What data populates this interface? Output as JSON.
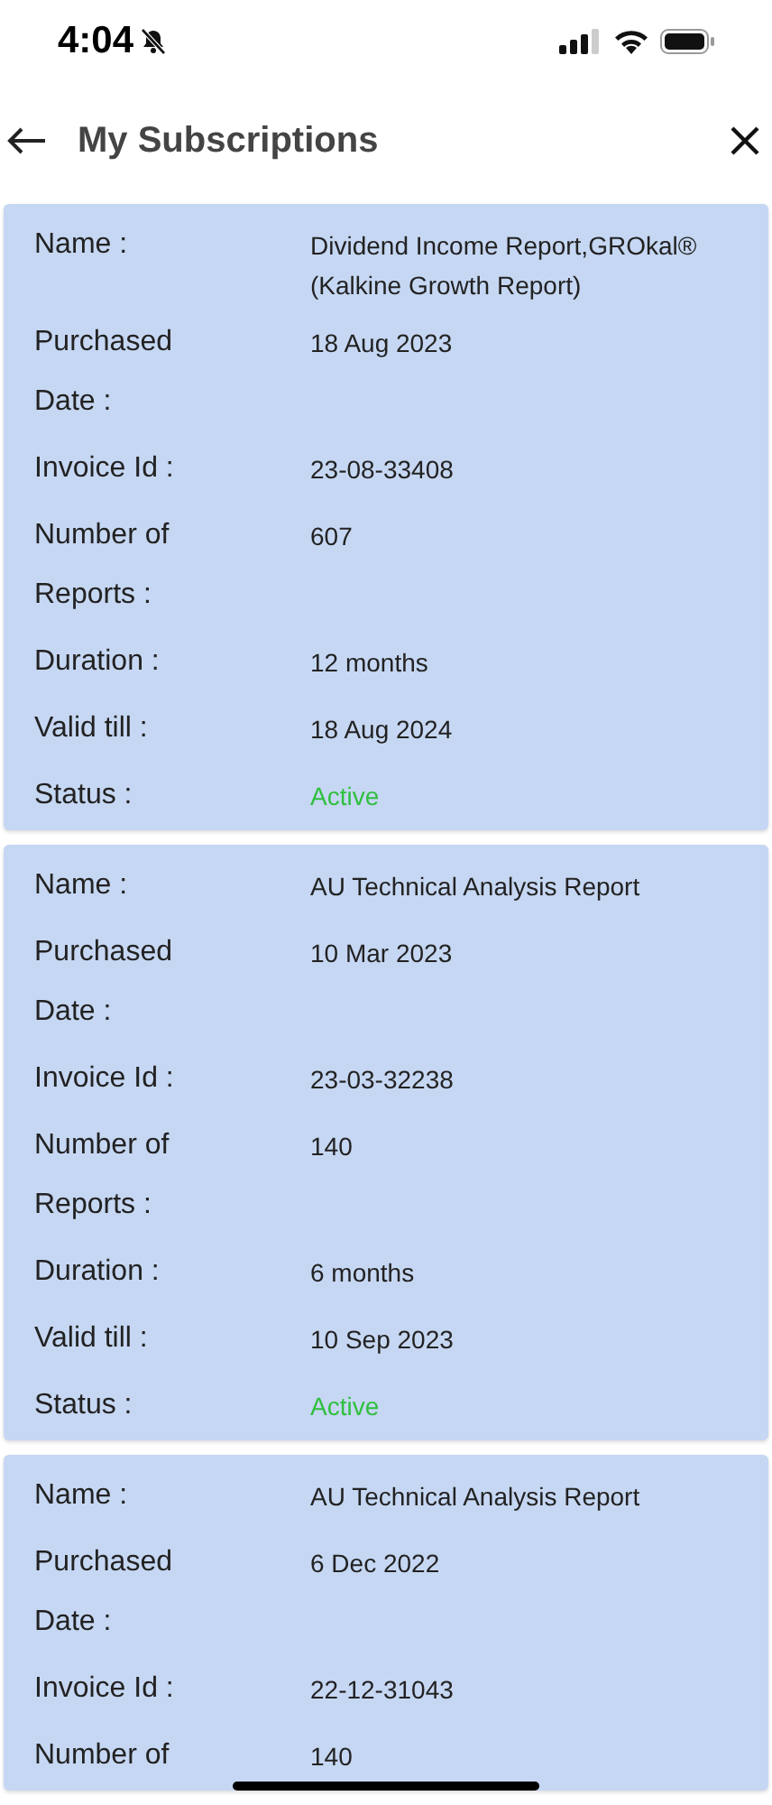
{
  "status_bar": {
    "time": "4:04"
  },
  "header": {
    "title": "My Subscriptions"
  },
  "subscriptions": [
    {
      "fields": [
        {
          "kind": "text",
          "label": "Name :",
          "value": "Dividend Income Report,GROkal®  (Kalkine Growth Report)"
        },
        {
          "kind": "text",
          "label": "Purchased Date :",
          "value": "18 Aug 2023"
        },
        {
          "kind": "text",
          "label": "Invoice Id :",
          "value": "23-08-33408"
        },
        {
          "kind": "text",
          "label": "Number of Reports :",
          "value": "607"
        },
        {
          "kind": "text",
          "label": "Duration :",
          "value": "12 months"
        },
        {
          "kind": "text",
          "label": "Valid till :",
          "value": "18 Aug 2024"
        },
        {
          "kind": "status",
          "label": "Status :",
          "value": "Active"
        }
      ]
    },
    {
      "fields": [
        {
          "kind": "text",
          "label": "Name :",
          "value": "AU Technical Analysis Report"
        },
        {
          "kind": "text",
          "label": "Purchased Date :",
          "value": "10 Mar 2023"
        },
        {
          "kind": "text",
          "label": "Invoice Id :",
          "value": "23-03-32238"
        },
        {
          "kind": "text",
          "label": "Number of Reports :",
          "value": "140"
        },
        {
          "kind": "text",
          "label": "Duration :",
          "value": "6 months"
        },
        {
          "kind": "text",
          "label": "Valid till :",
          "value": "10 Sep 2023"
        },
        {
          "kind": "status",
          "label": "Status :",
          "value": "Active"
        }
      ]
    },
    {
      "fields": [
        {
          "kind": "text",
          "label": "Name :",
          "value": "AU Technical Analysis Report"
        },
        {
          "kind": "text",
          "label": "Purchased Date :",
          "value": "6 Dec 2022"
        },
        {
          "kind": "text",
          "label": "Invoice Id :",
          "value": "22-12-31043"
        },
        {
          "kind": "text",
          "label": "Number of",
          "value": "140"
        }
      ]
    }
  ]
}
